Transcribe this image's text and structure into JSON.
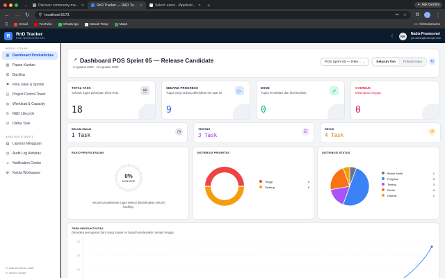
{
  "browser": {
    "tabs": [
      {
        "title": "Discover community-made i...",
        "color": "#9aa0a6",
        "active": false
      },
      {
        "title": "RnD Tracker — R&D Task Ma...",
        "color": "#3b82f6",
        "active": true
      },
      {
        "title": "Select: users - /Application...",
        "color": "#e8eaed",
        "active": false
      }
    ],
    "ask_label": "Ask Gemini",
    "url": "localhost:5173",
    "bookmarks": [
      {
        "label": "Gmail",
        "color": "#ea4335"
      },
      {
        "label": "YouTube",
        "color": "#ff0000"
      },
      {
        "label": "WhatsApp",
        "color": "#25d366"
      },
      {
        "label": "Masuk Tesqi",
        "color": "#e8eaed"
      },
      {
        "label": "Maps",
        "color": "#34a853"
      }
    ],
    "all_bookmarks": "All Bookmarks"
  },
  "app": {
    "logo_letter": "R",
    "name": "RnD Tracker",
    "subtitle": "R&D WORKSTATION",
    "user_initials": "NA",
    "user_name": "Nadia Pramesvari",
    "user_email": "pm.admin@example.com"
  },
  "sidebar": {
    "section1": "MODUL UTAMA",
    "items1": [
      {
        "label": "Dashboard Produktivitas",
        "icon": "grid-icon",
        "glyph": "▦",
        "active": true
      },
      {
        "label": "Papan Kanban",
        "icon": "kanban-icon",
        "glyph": "▥",
        "active": false
      },
      {
        "label": "Backlog",
        "icon": "list-icon",
        "glyph": "☰",
        "active": false
      },
      {
        "label": "Peta Jalan & Sprints",
        "icon": "map-icon",
        "glyph": "⚑",
        "active": false
      },
      {
        "label": "Project Control Tower",
        "icon": "tower-icon",
        "glyph": "◫",
        "active": false
      },
      {
        "label": "Workload & Capacity",
        "icon": "users-icon",
        "glyph": "◎",
        "active": false
      },
      {
        "label": "R&D Lifecycle",
        "icon": "cycle-icon",
        "glyph": "↻",
        "active": false
      },
      {
        "label": "Daftar Task",
        "icon": "checklist-icon",
        "glyph": "☑",
        "active": false
      }
    ],
    "section2": "ANALISIS & AUDIT",
    "items2": [
      {
        "label": "Laporan Mingguan",
        "icon": "report-icon",
        "glyph": "▤",
        "active": false
      },
      {
        "label": "Audit Log Aktivitas",
        "icon": "clock-icon",
        "glyph": "◷",
        "active": false
      },
      {
        "label": "Notification Center",
        "icon": "bell-icon",
        "glyph": "♫",
        "active": false
      },
      {
        "label": "Kelola Workspace",
        "icon": "workspace-icon",
        "glyph": "⚙",
        "active": false
      }
    ],
    "footer1": "Indexed Server: Aktif",
    "footer2": "Server: Online"
  },
  "header": {
    "title": "Dashboard POS Sprint 05 — Release Candidate",
    "date_range": "3 Agustus 2026 - 16 Agustus 2026",
    "sprint_select": "POS Sprint 05 — Rele...",
    "seg_team": "Seluruh Tim",
    "seg_me": "Pribadi Saya"
  },
  "kpi": [
    {
      "title": "TOTAL TASK",
      "desc": "Seluruh tugas pekerjaan divisi RnD.",
      "value": "18",
      "color": "#111827",
      "icon": "list-check-icon",
      "glyph": "☷",
      "icon_bg": "#e5e7eb",
      "icon_color": "#374151"
    },
    {
      "title": "SEDANG PROGRESS",
      "desc": "Tugas yang sedang dikerjakan tim saat ini.",
      "value": "9",
      "color": "#2563eb",
      "icon": "play-icon",
      "glyph": "▷",
      "icon_bg": "#dbeafe",
      "icon_color": "#2563eb"
    },
    {
      "title": "DONE",
      "desc": "Tugas tervalidasi dan diselesaikan.",
      "value": "0",
      "color": "#10b981",
      "icon": "send-icon",
      "glyph": "➚",
      "icon_bg": "#d1fae5",
      "icon_color": "#059669"
    },
    {
      "title": "OVERDUE",
      "desc": "Melampaui tenggat.",
      "value": "0",
      "color": "#e11d48",
      "icon": "alert-icon",
      "glyph": "!",
      "icon_bg": "#ffe4e6",
      "icon_color": "#e11d48"
    }
  ],
  "status_cards": [
    {
      "title": "BELUM MULAI",
      "value": "1 Task",
      "color": "#111827",
      "icon": "clock-icon",
      "glyph": "◷",
      "icon_bg": "#e5e7eb",
      "icon_color": "#374151"
    },
    {
      "title": "TESTING",
      "value": "3 Task",
      "color": "#9333ea",
      "icon": "check-square-icon",
      "glyph": "☑",
      "icon_bg": "#f3e8ff",
      "icon_color": "#9333ea"
    },
    {
      "title": "REVISI",
      "value": "4 Task",
      "color": "#d97706",
      "icon": "history-icon",
      "glyph": "↺",
      "icon_bg": "#fef3c7",
      "icon_color": "#d97706"
    }
  ],
  "completion": {
    "title": "RASIO PENYELESAIAN",
    "percent": "0%",
    "label": "DONE RATE",
    "desc": "Akurasi produktivitas tugas selesai dibandingkan seluruh backlog."
  },
  "priority": {
    "title": "DISTRIBUSI PRIORITAS",
    "items": [
      {
        "label": "Tinggi",
        "count": "9",
        "value": 9,
        "color": "#ef4444"
      },
      {
        "label": "Sedang",
        "count": "9",
        "value": 9,
        "color": "#f59e0b"
      }
    ]
  },
  "status_dist": {
    "title": "DISTRIBUSI STATUS",
    "items": [
      {
        "label": "Belum Mulai",
        "count": "1",
        "value": 1,
        "color": "#6b7280"
      },
      {
        "label": "Progress",
        "count": "9",
        "value": 9,
        "color": "#3b82f6"
      },
      {
        "label": "Testing",
        "count": "3",
        "value": 3,
        "color": "#a855f7"
      },
      {
        "label": "Revisi",
        "count": "4",
        "value": 4,
        "color": "#f97316"
      },
      {
        "label": "Diturnis",
        "count": "1",
        "value": 1,
        "color": "#f59e0b"
      }
    ]
  },
  "trend": {
    "title": "TREN PRODUKTIVITAS",
    "desc": "Dinamika penugasan baru yang masuk vs target terselesaikan setiap minggu.",
    "yticks": [
      "20",
      "15",
      "10"
    ],
    "line_color": "#3b82f6"
  }
}
